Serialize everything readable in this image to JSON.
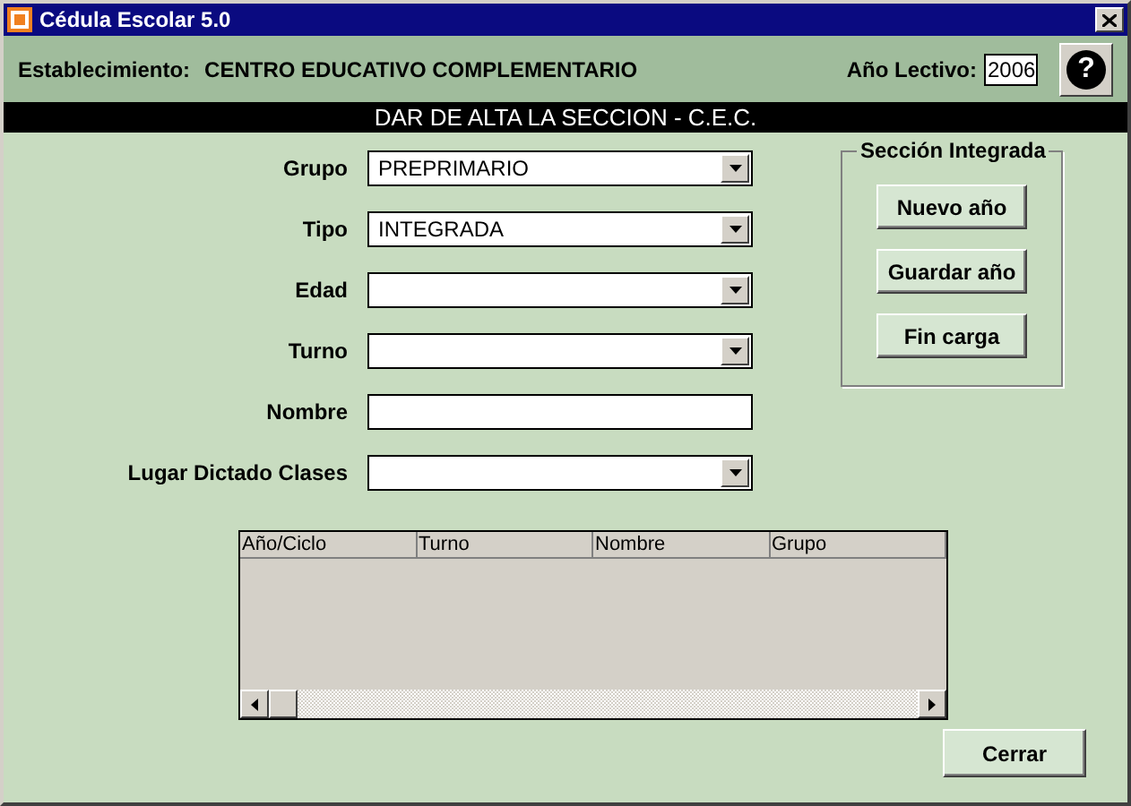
{
  "window": {
    "title": "Cédula Escolar 5.0"
  },
  "header": {
    "establishment_label": "Establecimiento:",
    "establishment": "CENTRO EDUCATIVO COMPLEMENTARIO",
    "year_label": "Año Lectivo:",
    "year": "2006",
    "help": "?"
  },
  "banner": "DAR DE ALTA LA SECCION - C.E.C.",
  "fields": [
    {
      "label": "Grupo",
      "kind": "combo",
      "value": "PREPRIMARIO"
    },
    {
      "label": "Tipo",
      "kind": "combo",
      "value": "INTEGRADA"
    },
    {
      "label": "Edad",
      "kind": "combo"
    },
    {
      "label": "Turno",
      "kind": "combo"
    },
    {
      "label": "Nombre",
      "kind": "text"
    },
    {
      "label": "Lugar Dictado Clases",
      "kind": "combo"
    }
  ],
  "group": {
    "title": "Sección Integrada",
    "buttons": [
      "Nuevo año",
      "Guardar año",
      "Fin carga"
    ]
  },
  "table": {
    "columns": [
      "Año/Ciclo",
      "Turno",
      "Nombre",
      "Grupo"
    ]
  },
  "buttons": [
    "Cerrar"
  ]
}
